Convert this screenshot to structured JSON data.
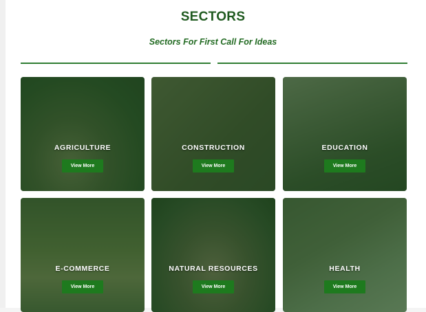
{
  "header": {
    "title": "SECTORS",
    "subtitle": "Sectors For First Call For Ideas"
  },
  "sectors": [
    {
      "name": "AGRICULTURE",
      "button": "View More"
    },
    {
      "name": "CONSTRUCTION",
      "button": "View More"
    },
    {
      "name": "EDUCATION",
      "button": "View More"
    },
    {
      "name": "E-COMMERCE",
      "button": "View More"
    },
    {
      "name": "NATURAL RESOURCES",
      "button": "View More"
    },
    {
      "name": "HEALTH",
      "button": "View More"
    }
  ],
  "colors": {
    "heading": "#1f5a1f",
    "accent": "#1e7a1e",
    "overlay": "#1c4a1c"
  }
}
